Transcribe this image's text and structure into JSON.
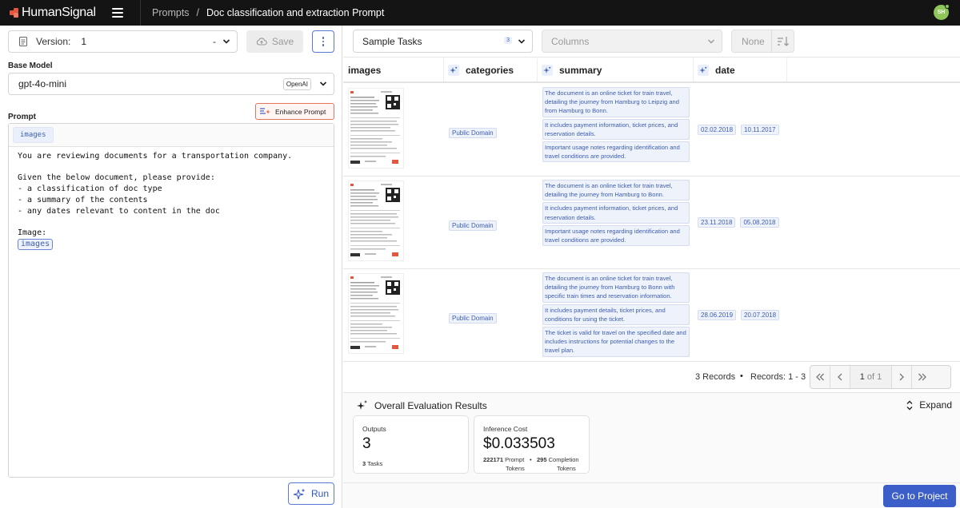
{
  "brand": {
    "name": "HumanSignal",
    "accent": "#e3563f"
  },
  "breadcrumb": {
    "root": "Prompts",
    "separator": "/",
    "current": "Doc classification and extraction Prompt"
  },
  "user": {
    "initials": "SH",
    "avatar_color": "#8ec65a"
  },
  "left_panel": {
    "version_label": "Version:",
    "version_value": "1",
    "version_suffix": "-",
    "save_label": "Save",
    "base_model_label": "Base Model",
    "model_name": "gpt-4o-mini",
    "model_provider": "OpenAI",
    "enhance_label": "Enhance Prompt",
    "prompt_label": "Prompt",
    "prompt_variable_chip": "images",
    "prompt_lines": [
      "You are reviewing documents for a transportation company.",
      "",
      "Given the below document, please provide:",
      "- a classification of doc type",
      "- a summary of the contents",
      "- any dates relevant to content in the doc",
      "",
      "Image:"
    ],
    "prompt_inline_variable": "images",
    "run_label": "Run"
  },
  "toolbar": {
    "sample_tasks_label": "Sample Tasks",
    "sample_tasks_count": "3",
    "columns_placeholder": "Columns",
    "sort_value": "None"
  },
  "table": {
    "columns": [
      "images",
      "categories",
      "summary",
      "date"
    ],
    "rows": [
      {
        "category": "Public Domain",
        "summary": [
          "The document is an online ticket for train travel, detailing the journey from Hamburg to Leipzig and from Hamburg to Bonn.",
          "It includes payment information, ticket prices, and reservation details.",
          "Important usage notes regarding identification and travel conditions are provided."
        ],
        "dates": [
          "02.02.2018",
          "10.11.2017"
        ]
      },
      {
        "category": "Public Domain",
        "summary": [
          "The document is an online ticket for train travel, detailing the journey from Hamburg to Bonn.",
          "It includes payment information, ticket prices, and reservation details.",
          "Important usage notes regarding identification and travel conditions are provided."
        ],
        "dates": [
          "23.11.2018",
          "05.08.2018"
        ]
      },
      {
        "category": "Public Domain",
        "summary": [
          "The document is an online ticket for train travel, detailing the journey from Hamburg to Bonn with specific train times and reservation information.",
          "It includes payment details, ticket prices, and conditions for using the ticket.",
          "The ticket is valid for travel on the specified date and includes instructions for potential changes to the travel plan."
        ],
        "dates": [
          "28.06.2019",
          "20.07.2018"
        ]
      }
    ]
  },
  "pager": {
    "records_count": "3 Records",
    "dot": "•",
    "records_range": "Records: 1 - 3",
    "page_current": "1",
    "page_of": "of 1"
  },
  "evaluation": {
    "title": "Overall Evaluation Results",
    "expand_label": "Expand",
    "outputs_title": "Outputs",
    "outputs_value": "3",
    "outputs_sub_count": "3",
    "outputs_sub_label": "Tasks",
    "cost_title": "Inference Cost",
    "cost_value": "$0.033503",
    "prompt_tokens_value": "222171",
    "prompt_tokens_label_1": "Prompt",
    "prompt_tokens_label_2": "Tokens",
    "token_dot": "•",
    "completion_tokens_value": "295",
    "completion_tokens_label_1": "Completion",
    "completion_tokens_label_2": "Tokens"
  },
  "footer": {
    "goto_label": "Go to Project"
  }
}
